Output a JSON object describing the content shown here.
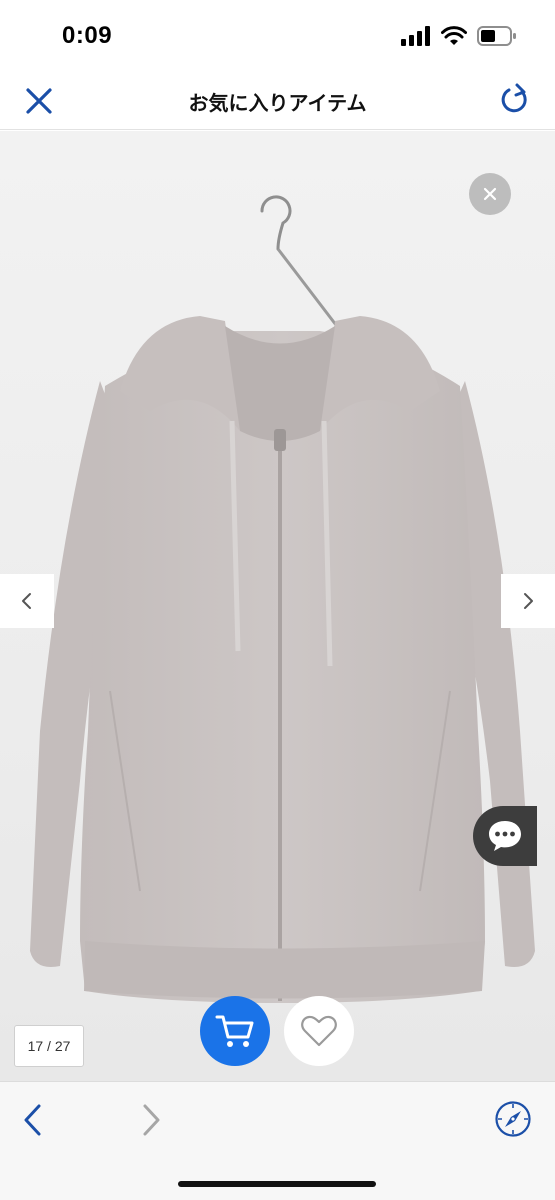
{
  "status": {
    "time": "0:09"
  },
  "nav": {
    "title": "お気に入りアイテム"
  },
  "gallery": {
    "current": "17 / 27"
  },
  "icons": {
    "close": "close-icon",
    "reload": "reload-icon",
    "dismiss": "close-icon",
    "prev": "chevron-left-icon",
    "next": "chevron-right-icon",
    "chat": "chat-icon",
    "cart": "cart-icon",
    "favorite": "heart-icon",
    "compass": "compass-icon"
  },
  "colors": {
    "accent": "#1a73e8",
    "garment": "#c9c3c2"
  }
}
